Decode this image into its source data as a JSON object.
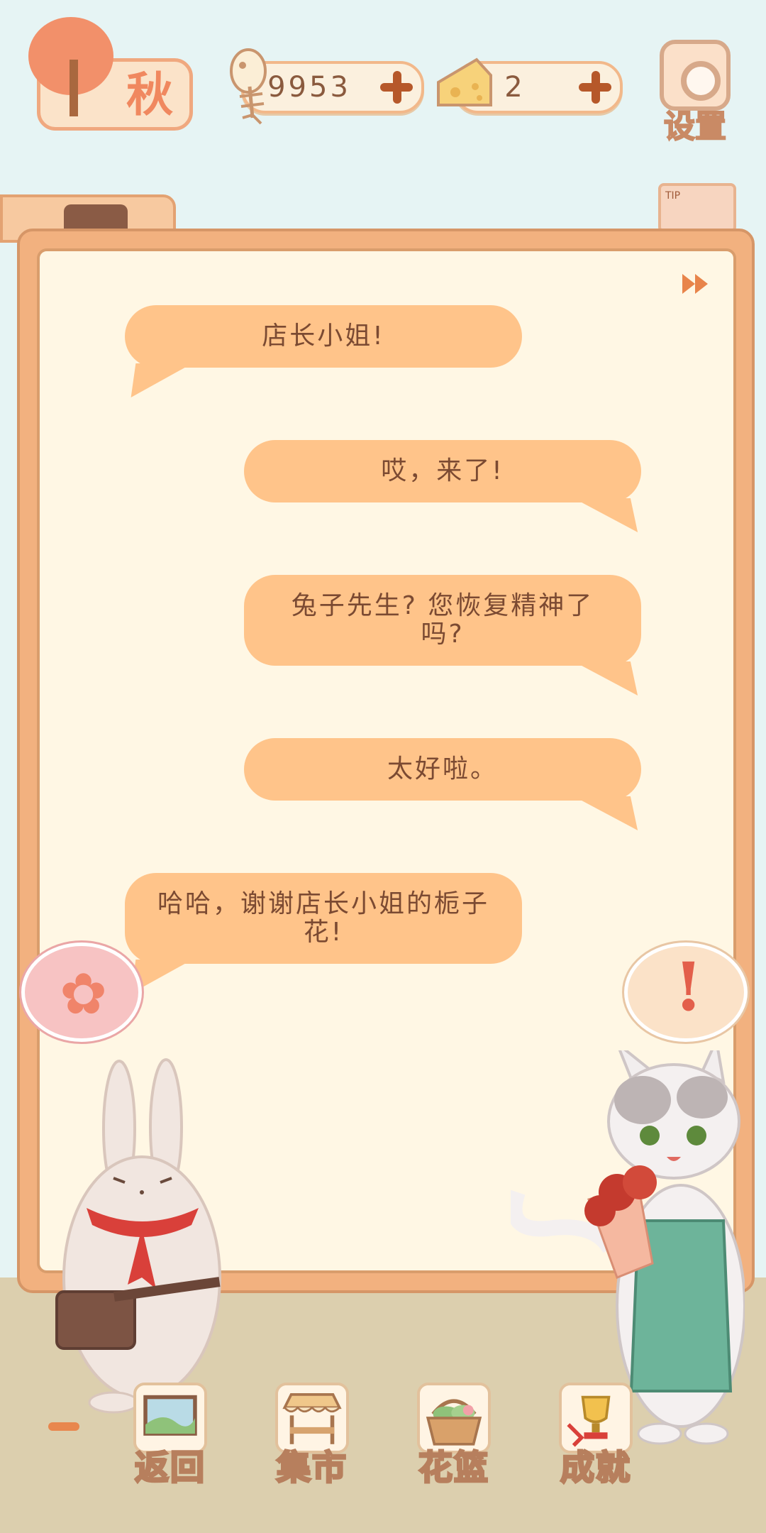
{
  "hud": {
    "season_label": "秋",
    "fish_count": "9953",
    "cheese_count": "2",
    "settings_label": "设置",
    "tip_label": "TIP"
  },
  "dialogue": {
    "messages": [
      {
        "speaker": "rabbit",
        "side": "left",
        "text": "店长小姐!"
      },
      {
        "speaker": "shopkeeper",
        "side": "right",
        "text": "哎，来了!"
      },
      {
        "speaker": "shopkeeper",
        "side": "right",
        "text": "兔子先生? 您恢复精神了吗?"
      },
      {
        "speaker": "shopkeeper",
        "side": "right",
        "text": "太好啦。"
      },
      {
        "speaker": "rabbit",
        "side": "left",
        "text": "哈哈，谢谢店长小姐的栀子花!"
      }
    ]
  },
  "emotes": {
    "rabbit": "flower-icon",
    "shopkeeper": "!"
  },
  "nav": {
    "items": [
      {
        "label": "返回",
        "icon": "window-icon"
      },
      {
        "label": "集市",
        "icon": "market-stall-icon"
      },
      {
        "label": "花篮",
        "icon": "flower-basket-icon"
      },
      {
        "label": "成就",
        "icon": "trophy-icon"
      }
    ]
  },
  "colors": {
    "sky": "#e6f4f4",
    "board": "#f2b17f",
    "paper": "#fff7e4",
    "bubble": "#ffc48a",
    "text": "#7b4a32"
  }
}
